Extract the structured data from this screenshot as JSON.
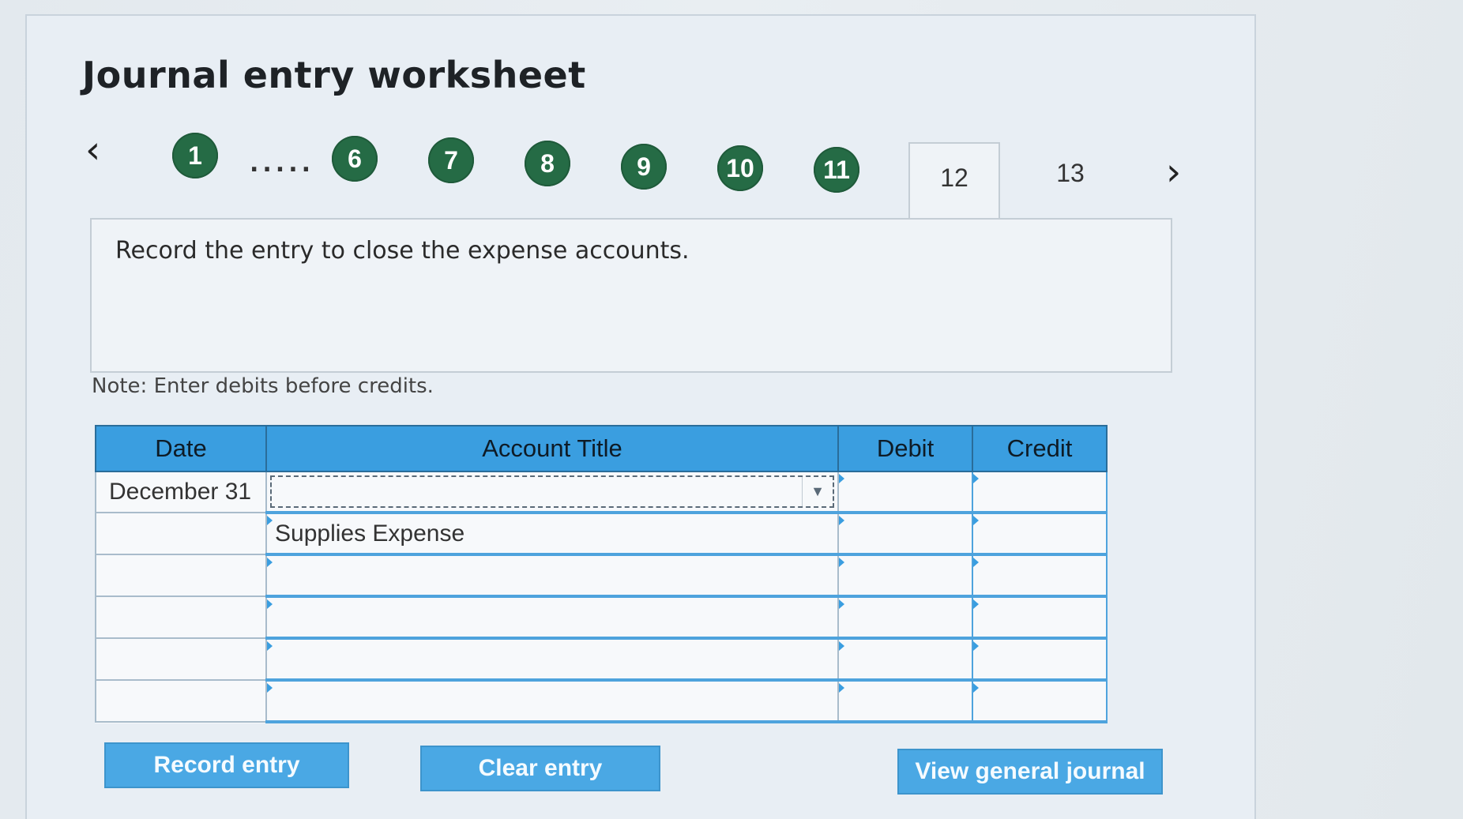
{
  "title": "Journal entry worksheet",
  "nav": {
    "prev_icon": "chevron-left-icon",
    "next_icon": "chevron-right-icon",
    "prev_glyph": "‹",
    "next_glyph": "›",
    "ellipsis": ".....",
    "steps": [
      "1",
      "6",
      "7",
      "8",
      "9",
      "10",
      "11"
    ],
    "tabs": [
      "12",
      "13"
    ],
    "active_tab": "12",
    "completed_color": "#256b45"
  },
  "instruction": "Record the entry to close the expense accounts.",
  "note": "Note: Enter debits before credits.",
  "table": {
    "headers": {
      "date": "Date",
      "account": "Account Title",
      "debit": "Debit",
      "credit": "Credit"
    },
    "rows": [
      {
        "date": "December 31",
        "account": "",
        "debit": "",
        "credit": ""
      },
      {
        "date": "",
        "account": "Supplies Expense",
        "debit": "",
        "credit": ""
      },
      {
        "date": "",
        "account": "",
        "debit": "",
        "credit": ""
      },
      {
        "date": "",
        "account": "",
        "debit": "",
        "credit": ""
      },
      {
        "date": "",
        "account": "",
        "debit": "",
        "credit": ""
      },
      {
        "date": "",
        "account": "",
        "debit": "",
        "credit": ""
      }
    ],
    "header_color": "#3a9ee0"
  },
  "buttons": {
    "record": "Record entry",
    "clear": "Clear entry",
    "view": "View general journal",
    "color": "#4aa8e4"
  }
}
